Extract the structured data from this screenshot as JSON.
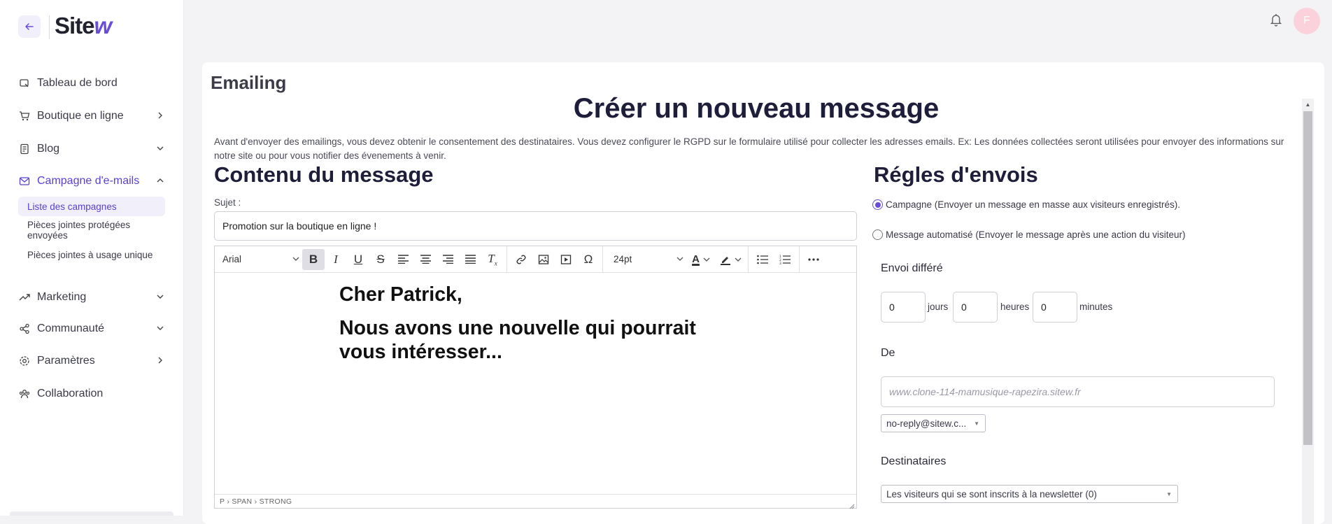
{
  "logo": {
    "prefix": "Site",
    "suffix": "w"
  },
  "sidebar": {
    "items": [
      {
        "label": "Tableau de bord"
      },
      {
        "label": "Boutique en ligne"
      },
      {
        "label": "Blog"
      },
      {
        "label": "Campagne d'e-mails"
      },
      {
        "label": "Marketing"
      },
      {
        "label": "Communauté"
      },
      {
        "label": "Paramètres"
      },
      {
        "label": "Collaboration"
      }
    ],
    "sub_items": [
      {
        "label": "Liste des campagnes"
      },
      {
        "label": "Pièces jointes protégées envoyées"
      },
      {
        "label": "Pièces jointes à usage unique"
      }
    ]
  },
  "user": {
    "initial": "F",
    "avatar_color": "#fbd1dc"
  },
  "colors": {
    "accent": "#6a4cd6",
    "heading": "#1e1e3a"
  },
  "page": {
    "section_title": "Emailing",
    "title": "Créer un nouveau message",
    "notice": "Avant d'envoyer des emailings, vous devez obtenir le consentement des destinataires. Vous devez configurer le RGPD sur le formulaire utilisé pour collecter les adresses emails. Ex: Les données collectées seront utilisées pour envoyer des informations sur notre site ou pour vous notifier des évenements à venir."
  },
  "content": {
    "title": "Contenu du message",
    "subject_label": "Sujet :",
    "subject_value": "Promotion sur la boutique en ligne !",
    "toolbar": {
      "font": "Arial",
      "size": "24pt"
    },
    "body": {
      "line1": "Cher Patrick,",
      "line2a": "Nous avons une nouvelle qui pourrait",
      "line2b": "vous intéresser..."
    },
    "statusbar": "P › SPAN › STRONG"
  },
  "rules": {
    "title": "Régles d'envois",
    "radio_campaign": "Campagne (Envoyer un message en masse aux visiteurs enregistrés).",
    "radio_auto": "Message automatisé (Envoyer le message après une action du visiteur)",
    "selected": "campaign",
    "delay": {
      "title": "Envoi différé",
      "days": "0",
      "days_unit": "jours",
      "hours": "0",
      "hours_unit": "heures",
      "minutes": "0",
      "minutes_unit": "minutes"
    },
    "from": {
      "title": "De",
      "placeholder": "www.clone-114-mamusique-rapezira.sitew.fr",
      "sender": "no-reply@sitew.c..."
    },
    "recipients": {
      "title": "Destinataires",
      "value": "Les visiteurs qui se sont inscrits à la newsletter (0)"
    }
  }
}
